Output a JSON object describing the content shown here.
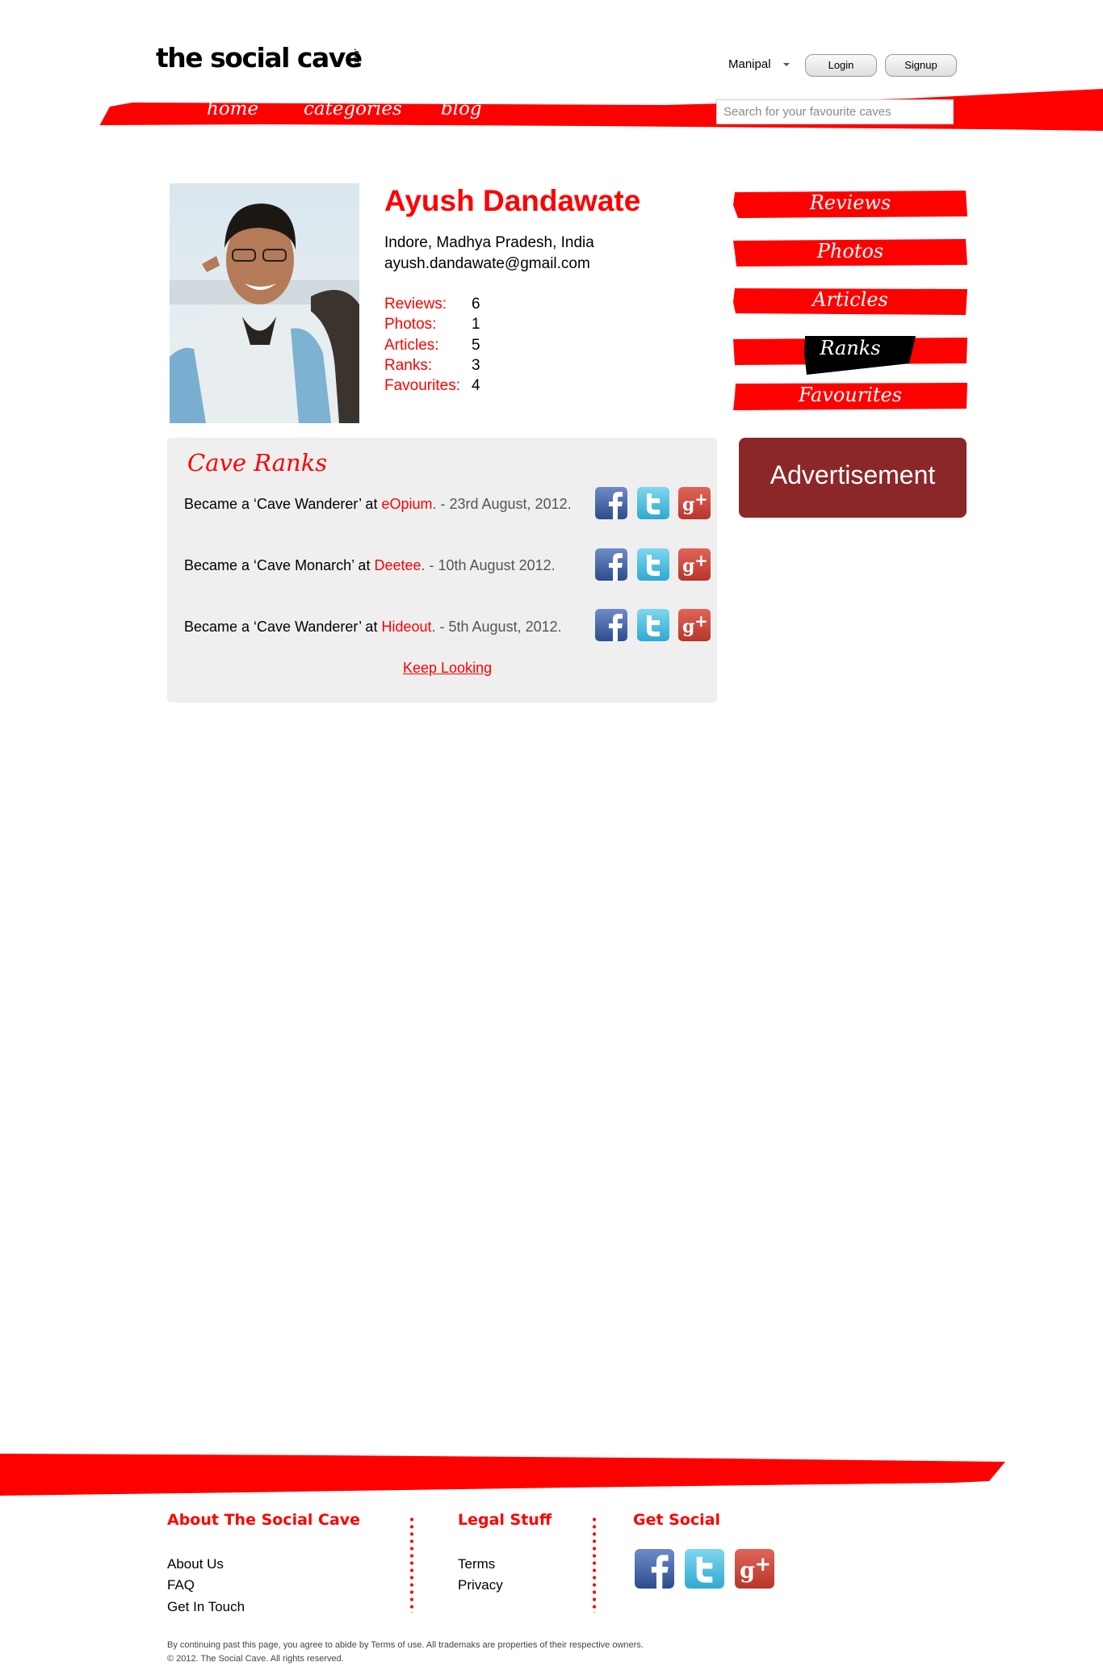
{
  "header": {
    "logo_text": "the social cave",
    "logo_suffix": ".com",
    "location": "Manipal",
    "login_label": "Login",
    "signup_label": "Signup",
    "nav": [
      {
        "label": "home"
      },
      {
        "label": "categories"
      },
      {
        "label": "blog"
      }
    ],
    "search_placeholder": "Search for your favourite caves"
  },
  "profile": {
    "name": "Ayush Dandawate",
    "location": "Indore, Madhya Pradesh, India",
    "email": "ayush.dandawate@gmail.com",
    "stats": [
      {
        "label": "Reviews:",
        "value": "6"
      },
      {
        "label": "Photos:",
        "value": "1"
      },
      {
        "label": "Articles:",
        "value": "5"
      },
      {
        "label": "Ranks:",
        "value": "3"
      },
      {
        "label": "Favourites:",
        "value": "4"
      }
    ]
  },
  "side_menu": {
    "items": [
      {
        "label": "Reviews"
      },
      {
        "label": "Photos"
      },
      {
        "label": "Articles"
      },
      {
        "label": "Ranks",
        "active": true
      },
      {
        "label": "Favourites"
      }
    ],
    "advertisement": "Advertisement"
  },
  "cave_ranks": {
    "title": "Cave Ranks",
    "items": [
      {
        "prefix": "Became a ‘Cave Wanderer’ at ",
        "place": "eOpium",
        "date": ". - 23rd August, 2012."
      },
      {
        "prefix": "Became a ‘Cave Monarch’ at ",
        "place": "Deetee",
        "date": ". - 10th August 2012."
      },
      {
        "prefix": "Became a ‘Cave Wanderer’ at ",
        "place": "Hideout",
        "date": ". - 5th August, 2012."
      }
    ],
    "keep_looking": "Keep Looking"
  },
  "footer": {
    "about_heading": "About The Social Cave",
    "about_links": [
      "About Us",
      "FAQ",
      "Get In Touch"
    ],
    "legal_heading": "Legal Stuff",
    "legal_links": [
      "Terms",
      "Privacy"
    ],
    "social_heading": "Get Social",
    "disclaimer": "By continuing past this page, you agree to abide by Terms of use. All trademaks are properties of their respective owners.",
    "copyright": "© 2012. The Social Cave. All rights reserved."
  },
  "colors": {
    "brand_red": "#ff0000",
    "ad_background": "#8b2729",
    "panel_background": "#efefef"
  }
}
